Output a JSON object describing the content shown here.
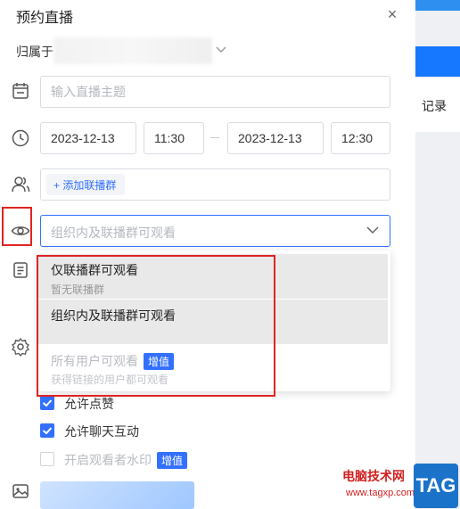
{
  "dialog": {
    "title": "预约直播",
    "close_glyph": "×"
  },
  "background": {
    "record_label": "记录"
  },
  "owner": {
    "label": "归属于"
  },
  "topic": {
    "placeholder": "输入直播主题"
  },
  "schedule": {
    "start_date": "2023-12-13",
    "start_time": "11:30",
    "end_date": "2023-12-13",
    "end_time": "12:30"
  },
  "groups": {
    "add_label": "+ 添加联播群"
  },
  "visibility": {
    "placeholder": "组织内及联播群可观看",
    "options": [
      {
        "title": "仅联播群可观看",
        "subtitle": "暂无联播群",
        "state": "hover"
      },
      {
        "title": "组织内及联播群可观看",
        "subtitle": "",
        "state": "selected"
      },
      {
        "title": "所有用户可观看",
        "badge": "增值",
        "subtitle": "获得链接的用户都可观看",
        "state": "disabled"
      }
    ]
  },
  "settings": {
    "allow_likes": {
      "label": "允许点赞",
      "checked": true
    },
    "allow_chat": {
      "label": "允许聊天互动",
      "checked": true
    },
    "watermark": {
      "label": "开启观看者水印",
      "badge": "增值",
      "checked": false
    }
  },
  "watermark_overlay": {
    "site": "电脑技术网",
    "url": "www.tagxp.com",
    "logo": "TAG"
  },
  "colors": {
    "accent": "#3370ff",
    "highlight": "#e02424"
  }
}
